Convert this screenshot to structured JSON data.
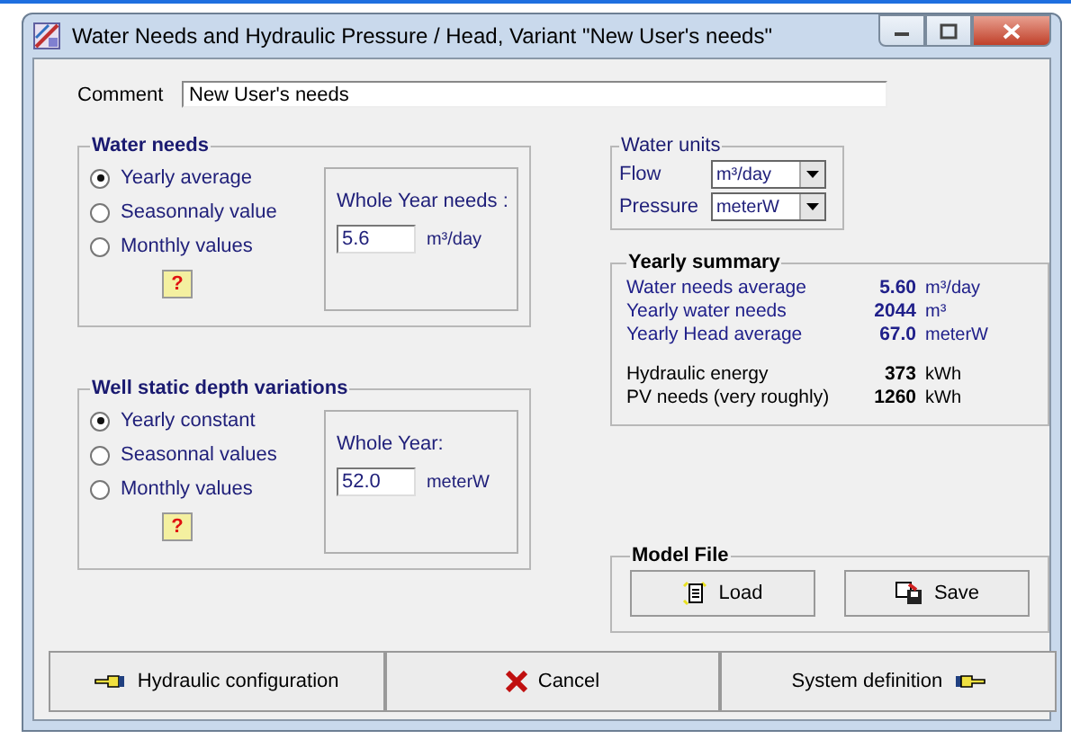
{
  "window": {
    "title": "Water Needs and Hydraulic Pressure / Head, Variant  \"New User's needs\""
  },
  "comment": {
    "label": "Comment",
    "value": "New User's needs"
  },
  "water_needs": {
    "title": "Water needs",
    "options": [
      {
        "label": "Yearly average",
        "selected": true
      },
      {
        "label": "Seasonnaly value",
        "selected": false
      },
      {
        "label": "Monthly values",
        "selected": false
      }
    ],
    "value_label": "Whole Year needs :",
    "value": "5.6",
    "unit": "m³/day",
    "help": "?"
  },
  "well_depth": {
    "title": "Well static depth variations",
    "options": [
      {
        "label": "Yearly constant",
        "selected": true
      },
      {
        "label": "Seasonnal values",
        "selected": false
      },
      {
        "label": "Monthly values",
        "selected": false
      }
    ],
    "value_label": "Whole Year:",
    "value": "52.0",
    "unit": "meterW",
    "help": "?"
  },
  "water_units": {
    "title": "Water units",
    "fields": [
      {
        "label": "Flow",
        "value": "m³/day"
      },
      {
        "label": "Pressure",
        "value": "meterW"
      }
    ]
  },
  "yearly_summary": {
    "title": "Yearly summary",
    "water_rows": [
      {
        "label": "Water needs average",
        "value": "5.60",
        "unit": "m³/day"
      },
      {
        "label": "Yearly water needs",
        "value": "2044",
        "unit": "m³"
      },
      {
        "label": "Yearly Head average",
        "value": "67.0",
        "unit": "meterW"
      }
    ],
    "energy_rows": [
      {
        "label": "Hydraulic energy",
        "value": "373",
        "unit": "kWh"
      },
      {
        "label": "PV needs (very roughly)",
        "value": "1260",
        "unit": "kWh"
      }
    ]
  },
  "model_file": {
    "title": "Model File",
    "buttons": [
      "Load",
      "Save"
    ]
  },
  "footer_buttons": [
    "Hydraulic configuration",
    "Cancel",
    "System definition"
  ]
}
